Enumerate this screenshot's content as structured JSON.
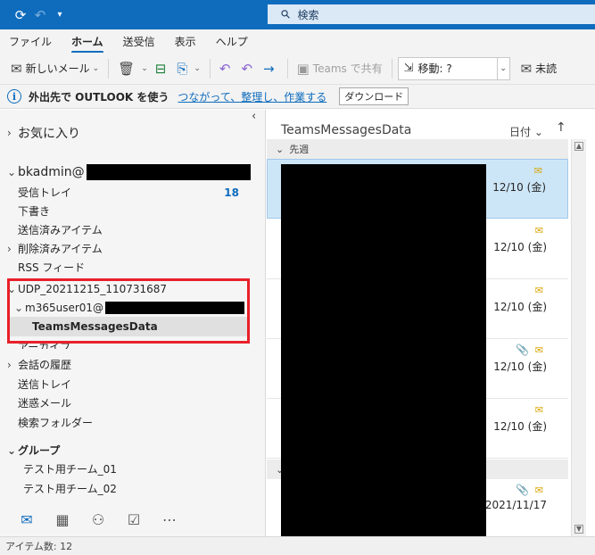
{
  "titlebar": {
    "search_placeholder": "検索"
  },
  "menu": {
    "items": [
      "ファイル",
      "ホーム",
      "送受信",
      "表示",
      "ヘルプ"
    ],
    "active_index": 1
  },
  "toolbar": {
    "new_mail": "新しいメール",
    "teams_share": "Teams で共有",
    "move": "移動: ?",
    "unread": "未読"
  },
  "infobar": {
    "text": "外出先で OUTLOOK を使う",
    "link": "つながって、整理し、作業する",
    "download": "ダウンロード"
  },
  "folders": {
    "favorites": "お気に入り",
    "account": "bkadmin@",
    "inbox": "受信トレイ",
    "inbox_count": "18",
    "drafts": "下書き",
    "sent": "送信済みアイテム",
    "deleted": "削除済みアイテム",
    "rss": "RSS フィード",
    "udp": "UDP_20211215_110731687",
    "m365": "m365user01@",
    "teams_data": "TeamsMessagesData",
    "archive": "アーカイブ",
    "conversation_history": "会話の履歴",
    "outbox": "送信トレイ",
    "junk": "迷惑メール",
    "search_folders": "検索フォルダー",
    "groups": "グループ",
    "group1": "テスト用チーム_01",
    "group2": "テスト用チーム_02"
  },
  "message_list": {
    "title": "TeamsMessagesData",
    "sort": "日付",
    "group_last_week": "先週",
    "messages": [
      {
        "date": "12/10 (金)",
        "attachment": false
      },
      {
        "date": "12/10 (金)",
        "attachment": false
      },
      {
        "date": "12/10 (金)",
        "attachment": false
      },
      {
        "date": "12/10 (金)",
        "attachment": true
      },
      {
        "date": "12/10 (金)",
        "attachment": false
      },
      {
        "date": "2021/11/17",
        "attachment": true
      }
    ]
  },
  "status": {
    "item_count": "アイテム数: 12"
  },
  "colors": {
    "accent": "#0f6cbd",
    "highlight": "#e8202a"
  }
}
